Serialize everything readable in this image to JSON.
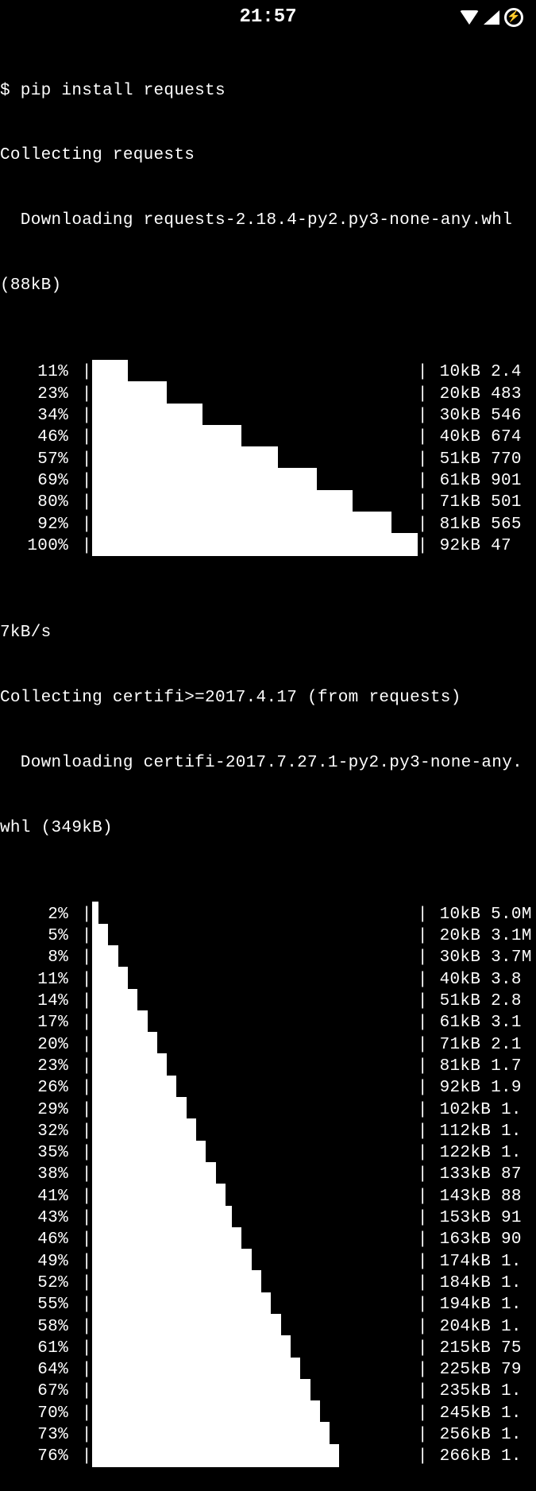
{
  "status_bar": {
    "time": "21:57",
    "bolt": "⚡"
  },
  "terminal": {
    "cmd_line": "$ pip install requests",
    "line_collect_requests": "Collecting requests",
    "line_dl_requests": "  Downloading requests-2.18.4-py2.py3-none-any.whl",
    "line_size_requests": "(88kB)",
    "requests_progress": [
      {
        "pct": "11%",
        "fill": 11,
        "suffix": " 10kB 2.4"
      },
      {
        "pct": "23%",
        "fill": 23,
        "suffix": " 20kB 483"
      },
      {
        "pct": "34%",
        "fill": 34,
        "suffix": " 30kB 546"
      },
      {
        "pct": "46%",
        "fill": 46,
        "suffix": " 40kB 674"
      },
      {
        "pct": "57%",
        "fill": 57,
        "suffix": " 51kB 770"
      },
      {
        "pct": "69%",
        "fill": 69,
        "suffix": " 61kB 901"
      },
      {
        "pct": "80%",
        "fill": 80,
        "suffix": " 71kB 501"
      },
      {
        "pct": "92%",
        "fill": 92,
        "suffix": " 81kB 565"
      },
      {
        "pct": "100%",
        "fill": 100,
        "suffix": " 92kB 47"
      }
    ],
    "line_wrap_7kbs": "7kB/s",
    "line_collect_certifi": "Collecting certifi>=2017.4.17 (from requests)",
    "line_dl_certifi": "  Downloading certifi-2017.7.27.1-py2.py3-none-any.",
    "line_size_certifi": "whl (349kB)",
    "certifi_progress": [
      {
        "pct": "2%",
        "fill": 2,
        "suffix": " 10kB 5.0M"
      },
      {
        "pct": "5%",
        "fill": 5,
        "suffix": " 20kB 3.1M"
      },
      {
        "pct": "8%",
        "fill": 8,
        "suffix": " 30kB 3.7M"
      },
      {
        "pct": "11%",
        "fill": 11,
        "suffix": " 40kB 3.8"
      },
      {
        "pct": "14%",
        "fill": 14,
        "suffix": " 51kB 2.8"
      },
      {
        "pct": "17%",
        "fill": 17,
        "suffix": " 61kB 3.1"
      },
      {
        "pct": "20%",
        "fill": 20,
        "suffix": " 71kB 2.1"
      },
      {
        "pct": "23%",
        "fill": 23,
        "suffix": " 81kB 1.7"
      },
      {
        "pct": "26%",
        "fill": 26,
        "suffix": " 92kB 1.9"
      },
      {
        "pct": "29%",
        "fill": 29,
        "suffix": " 102kB 1."
      },
      {
        "pct": "32%",
        "fill": 32,
        "suffix": " 112kB 1."
      },
      {
        "pct": "35%",
        "fill": 35,
        "suffix": " 122kB 1."
      },
      {
        "pct": "38%",
        "fill": 38,
        "suffix": " 133kB 87"
      },
      {
        "pct": "41%",
        "fill": 41,
        "suffix": " 143kB 88"
      },
      {
        "pct": "43%",
        "fill": 43,
        "suffix": " 153kB 91"
      },
      {
        "pct": "46%",
        "fill": 46,
        "suffix": " 163kB 90"
      },
      {
        "pct": "49%",
        "fill": 49,
        "suffix": " 174kB 1."
      },
      {
        "pct": "52%",
        "fill": 52,
        "suffix": " 184kB 1."
      },
      {
        "pct": "55%",
        "fill": 55,
        "suffix": " 194kB 1."
      },
      {
        "pct": "58%",
        "fill": 58,
        "suffix": " 204kB 1."
      },
      {
        "pct": "61%",
        "fill": 61,
        "suffix": " 215kB 75"
      },
      {
        "pct": "64%",
        "fill": 64,
        "suffix": " 225kB 79"
      },
      {
        "pct": "67%",
        "fill": 67,
        "suffix": " 235kB 1."
      },
      {
        "pct": "70%",
        "fill": 70,
        "suffix": " 245kB 1."
      },
      {
        "pct": "73%",
        "fill": 73,
        "suffix": " 256kB 1."
      },
      {
        "pct": "76%",
        "fill": 76,
        "suffix": " 266kB 1."
      }
    ]
  }
}
